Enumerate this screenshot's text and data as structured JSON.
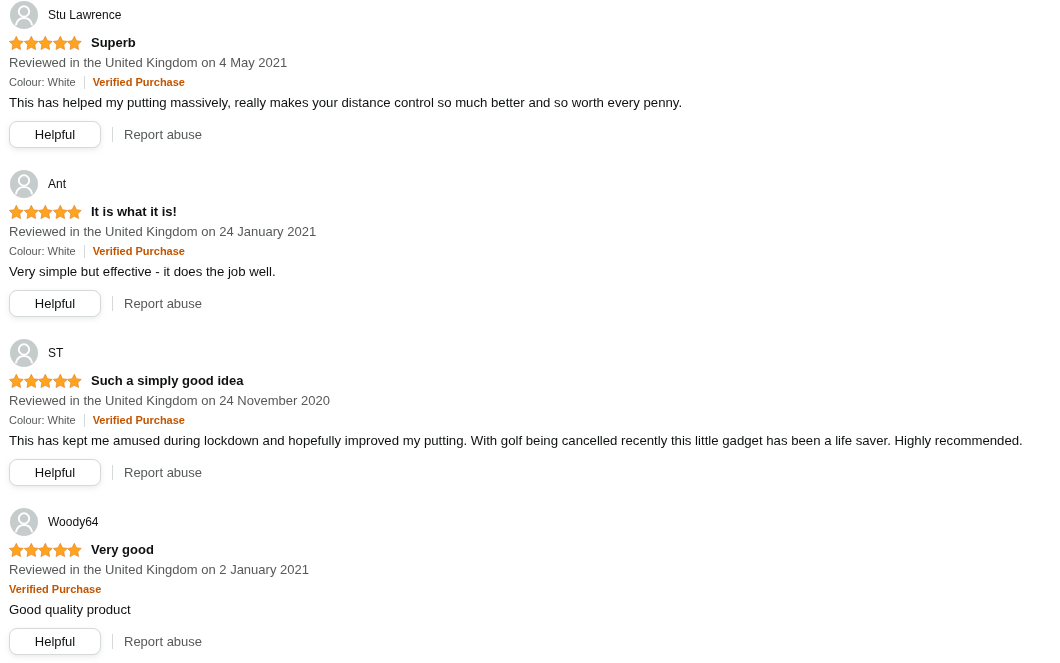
{
  "reviews": [
    {
      "reviewer": "Stu Lawrence",
      "stars": 5,
      "title": "Superb",
      "date_line": "Reviewed in the United Kingdom on 4 May 2021",
      "colour": "Colour: White",
      "verified": "Verified Purchase",
      "body": "This has helped my putting massively, really makes your distance control so much better and so worth every penny.",
      "helpful_button": "Helpful",
      "report_link": "Report abuse"
    },
    {
      "reviewer": "Ant",
      "stars": 5,
      "title": "It is what it is!",
      "date_line": "Reviewed in the United Kingdom on 24 January 2021",
      "colour": "Colour: White",
      "verified": "Verified Purchase",
      "body": "Very simple but effective - it does the job well.",
      "helpful_button": "Helpful",
      "report_link": "Report abuse"
    },
    {
      "reviewer": "ST",
      "stars": 5,
      "title": "Such a simply good idea",
      "date_line": "Reviewed in the United Kingdom on 24 November 2020",
      "colour": "Colour: White",
      "verified": "Verified Purchase",
      "body": "This has kept me amused during lockdown and hopefully improved my putting. With golf being cancelled recently this little gadget has been a life saver. Highly recommended.",
      "helpful_button": "Helpful",
      "report_link": "Report abuse"
    },
    {
      "reviewer": "Woody64",
      "stars": 5,
      "title": "Very good",
      "date_line": "Reviewed in the United Kingdom on 2 January 2021",
      "verified": "Verified Purchase",
      "body": "Good quality product",
      "helpful_button": "Helpful",
      "report_link": "Report abuse"
    }
  ]
}
